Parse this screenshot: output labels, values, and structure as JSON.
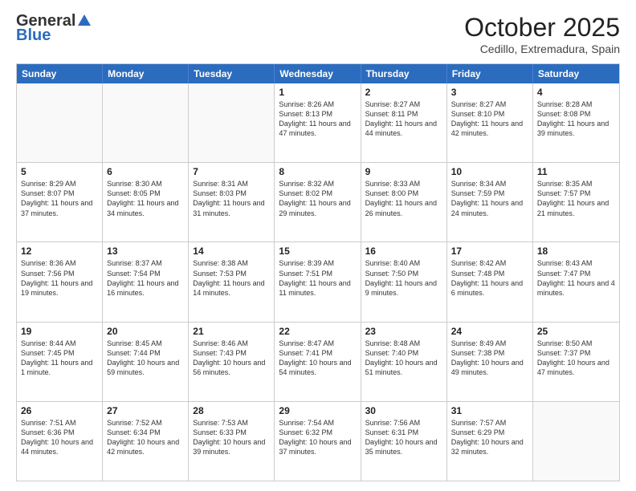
{
  "logo": {
    "general": "General",
    "blue": "Blue"
  },
  "title": "October 2025",
  "location": "Cedillo, Extremadura, Spain",
  "headers": [
    "Sunday",
    "Monday",
    "Tuesday",
    "Wednesday",
    "Thursday",
    "Friday",
    "Saturday"
  ],
  "weeks": [
    [
      {
        "day": "",
        "text": ""
      },
      {
        "day": "",
        "text": ""
      },
      {
        "day": "",
        "text": ""
      },
      {
        "day": "1",
        "text": "Sunrise: 8:26 AM\nSunset: 8:13 PM\nDaylight: 11 hours and 47 minutes."
      },
      {
        "day": "2",
        "text": "Sunrise: 8:27 AM\nSunset: 8:11 PM\nDaylight: 11 hours and 44 minutes."
      },
      {
        "day": "3",
        "text": "Sunrise: 8:27 AM\nSunset: 8:10 PM\nDaylight: 11 hours and 42 minutes."
      },
      {
        "day": "4",
        "text": "Sunrise: 8:28 AM\nSunset: 8:08 PM\nDaylight: 11 hours and 39 minutes."
      }
    ],
    [
      {
        "day": "5",
        "text": "Sunrise: 8:29 AM\nSunset: 8:07 PM\nDaylight: 11 hours and 37 minutes."
      },
      {
        "day": "6",
        "text": "Sunrise: 8:30 AM\nSunset: 8:05 PM\nDaylight: 11 hours and 34 minutes."
      },
      {
        "day": "7",
        "text": "Sunrise: 8:31 AM\nSunset: 8:03 PM\nDaylight: 11 hours and 31 minutes."
      },
      {
        "day": "8",
        "text": "Sunrise: 8:32 AM\nSunset: 8:02 PM\nDaylight: 11 hours and 29 minutes."
      },
      {
        "day": "9",
        "text": "Sunrise: 8:33 AM\nSunset: 8:00 PM\nDaylight: 11 hours and 26 minutes."
      },
      {
        "day": "10",
        "text": "Sunrise: 8:34 AM\nSunset: 7:59 PM\nDaylight: 11 hours and 24 minutes."
      },
      {
        "day": "11",
        "text": "Sunrise: 8:35 AM\nSunset: 7:57 PM\nDaylight: 11 hours and 21 minutes."
      }
    ],
    [
      {
        "day": "12",
        "text": "Sunrise: 8:36 AM\nSunset: 7:56 PM\nDaylight: 11 hours and 19 minutes."
      },
      {
        "day": "13",
        "text": "Sunrise: 8:37 AM\nSunset: 7:54 PM\nDaylight: 11 hours and 16 minutes."
      },
      {
        "day": "14",
        "text": "Sunrise: 8:38 AM\nSunset: 7:53 PM\nDaylight: 11 hours and 14 minutes."
      },
      {
        "day": "15",
        "text": "Sunrise: 8:39 AM\nSunset: 7:51 PM\nDaylight: 11 hours and 11 minutes."
      },
      {
        "day": "16",
        "text": "Sunrise: 8:40 AM\nSunset: 7:50 PM\nDaylight: 11 hours and 9 minutes."
      },
      {
        "day": "17",
        "text": "Sunrise: 8:42 AM\nSunset: 7:48 PM\nDaylight: 11 hours and 6 minutes."
      },
      {
        "day": "18",
        "text": "Sunrise: 8:43 AM\nSunset: 7:47 PM\nDaylight: 11 hours and 4 minutes."
      }
    ],
    [
      {
        "day": "19",
        "text": "Sunrise: 8:44 AM\nSunset: 7:45 PM\nDaylight: 11 hours and 1 minute."
      },
      {
        "day": "20",
        "text": "Sunrise: 8:45 AM\nSunset: 7:44 PM\nDaylight: 10 hours and 59 minutes."
      },
      {
        "day": "21",
        "text": "Sunrise: 8:46 AM\nSunset: 7:43 PM\nDaylight: 10 hours and 56 minutes."
      },
      {
        "day": "22",
        "text": "Sunrise: 8:47 AM\nSunset: 7:41 PM\nDaylight: 10 hours and 54 minutes."
      },
      {
        "day": "23",
        "text": "Sunrise: 8:48 AM\nSunset: 7:40 PM\nDaylight: 10 hours and 51 minutes."
      },
      {
        "day": "24",
        "text": "Sunrise: 8:49 AM\nSunset: 7:38 PM\nDaylight: 10 hours and 49 minutes."
      },
      {
        "day": "25",
        "text": "Sunrise: 8:50 AM\nSunset: 7:37 PM\nDaylight: 10 hours and 47 minutes."
      }
    ],
    [
      {
        "day": "26",
        "text": "Sunrise: 7:51 AM\nSunset: 6:36 PM\nDaylight: 10 hours and 44 minutes."
      },
      {
        "day": "27",
        "text": "Sunrise: 7:52 AM\nSunset: 6:34 PM\nDaylight: 10 hours and 42 minutes."
      },
      {
        "day": "28",
        "text": "Sunrise: 7:53 AM\nSunset: 6:33 PM\nDaylight: 10 hours and 39 minutes."
      },
      {
        "day": "29",
        "text": "Sunrise: 7:54 AM\nSunset: 6:32 PM\nDaylight: 10 hours and 37 minutes."
      },
      {
        "day": "30",
        "text": "Sunrise: 7:56 AM\nSunset: 6:31 PM\nDaylight: 10 hours and 35 minutes."
      },
      {
        "day": "31",
        "text": "Sunrise: 7:57 AM\nSunset: 6:29 PM\nDaylight: 10 hours and 32 minutes."
      },
      {
        "day": "",
        "text": ""
      }
    ]
  ]
}
